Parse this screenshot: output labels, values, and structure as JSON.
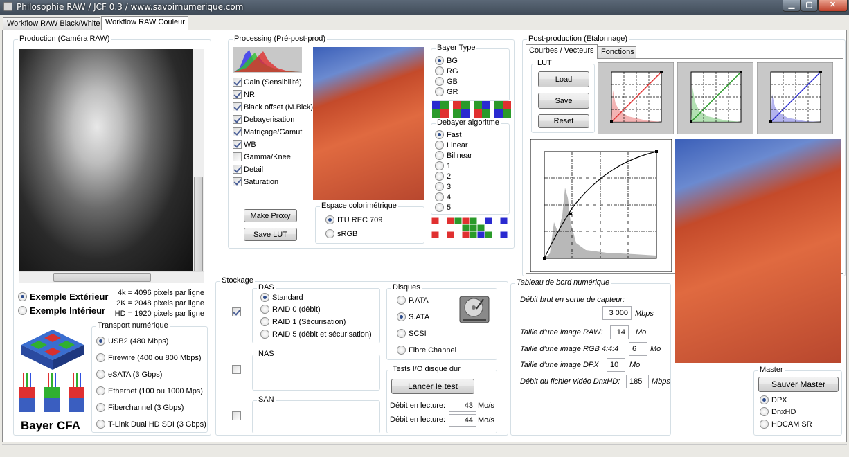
{
  "window": {
    "title": "Philosophie RAW / JCF 0.3 / www.savoirnumerique.com",
    "min": "▁",
    "max": "▢",
    "close": "✕"
  },
  "tabs": [
    {
      "label": "Workflow RAW Black/White"
    },
    {
      "label": "Workflow RAW Couleur"
    }
  ],
  "production": {
    "title": "Production (Caméra RAW)",
    "exterior": "Exemple Extérieur",
    "interior": "Exemple Intérieur",
    "res": [
      "4k = 4096 pixels par ligne",
      "2K = 2048 pixels par ligne",
      "HD = 1920 pixels par ligne"
    ],
    "cfa_label": "Bayer CFA",
    "transport": {
      "title": "Transport numérique",
      "items": [
        "USB2 (480 Mbps)",
        "Firewire (400 ou 800 Mbps)",
        "eSATA (3 Gbps)",
        "Ethernet (100 ou 1000 Mps)",
        "Fiberchannel (3 Gbps)",
        "T-Link Dual HD SDI (3 Gbps)"
      ]
    }
  },
  "processing": {
    "title": "Processing (Pré-post-prod)",
    "checks": [
      {
        "label": "Gain (Sensibilité)",
        "on": true
      },
      {
        "label": "NR",
        "on": true
      },
      {
        "label": "Black offset (M.Blck)",
        "on": true
      },
      {
        "label": "Debayerisation",
        "on": true
      },
      {
        "label": "Matriçage/Gamut",
        "on": true
      },
      {
        "label": "WB",
        "on": true
      },
      {
        "label": "Gamma/Knee",
        "on": false
      },
      {
        "label": "Detail",
        "on": true
      },
      {
        "label": "Saturation",
        "on": true
      }
    ],
    "make_proxy": "Make Proxy",
    "save_lut": "Save LUT",
    "bayer_type": {
      "title": "Bayer Type",
      "items": [
        "BG",
        "RG",
        "GB",
        "GR"
      ]
    },
    "debayer": {
      "title": "Debayer algoritme",
      "items": [
        "Fast",
        "Linear",
        "Bilinear",
        "1",
        "2",
        "3",
        "4",
        "5"
      ]
    },
    "espace": {
      "title": "Espace colorimétrique",
      "items": [
        "ITU REC 709",
        "sRGB"
      ]
    }
  },
  "postprod": {
    "title": "Post-production (Etalonnage)",
    "tabs": [
      "Courbes / Vecteurs",
      "Fonctions"
    ],
    "lut": {
      "title": "LUT",
      "load": "Load",
      "save": "Save",
      "reset": "Reset"
    },
    "colors": {
      "red": "#e03030",
      "green": "#2a9a2a",
      "blue": "#2a2ad0"
    }
  },
  "stockage": {
    "title": "Stockage",
    "das": {
      "title": "DAS",
      "items": [
        "Standard",
        "RAID 0 (débit)",
        "RAID 1 (Sécurisation)",
        "RAID 5 (débit et sécurisation)"
      ]
    },
    "nas": {
      "title": "NAS"
    },
    "san": {
      "title": "SAN"
    },
    "disques": {
      "title": "Disques",
      "items": [
        "P.ATA",
        "S.ATA",
        "SCSI",
        "Fibre Channel"
      ]
    },
    "tests": {
      "title": "Tests I/O disque dur",
      "button": "Lancer le test",
      "read1_label": "Débit en lecture:",
      "read1": "43",
      "read2_label": "Débit en lecture:",
      "read2": "44",
      "unit": "Mo/s"
    }
  },
  "tableau": {
    "title": "Tableau de bord numérique",
    "debit_label": "Débit brut en sortie de capteur:",
    "debit": "3 000",
    "debit_unit": "Mbps",
    "raw_label": "Taille d'une image RAW:",
    "raw": "14",
    "raw_unit": "Mo",
    "rgb_label": "Taille d'une image RGB 4:4:4",
    "rgb": "6",
    "rgb_unit": "Mo",
    "dpx_label": "Taille d'une image DPX",
    "dpx": "10",
    "dpx_unit": "Mo",
    "dnx_label": "Débit du fichier vidéo DnxHD:",
    "dnx": "185",
    "dnx_unit": "Mbps"
  },
  "master": {
    "title": "Master",
    "button": "Sauver Master",
    "items": [
      "DPX",
      "DnxHD",
      "HDCAM SR"
    ]
  }
}
